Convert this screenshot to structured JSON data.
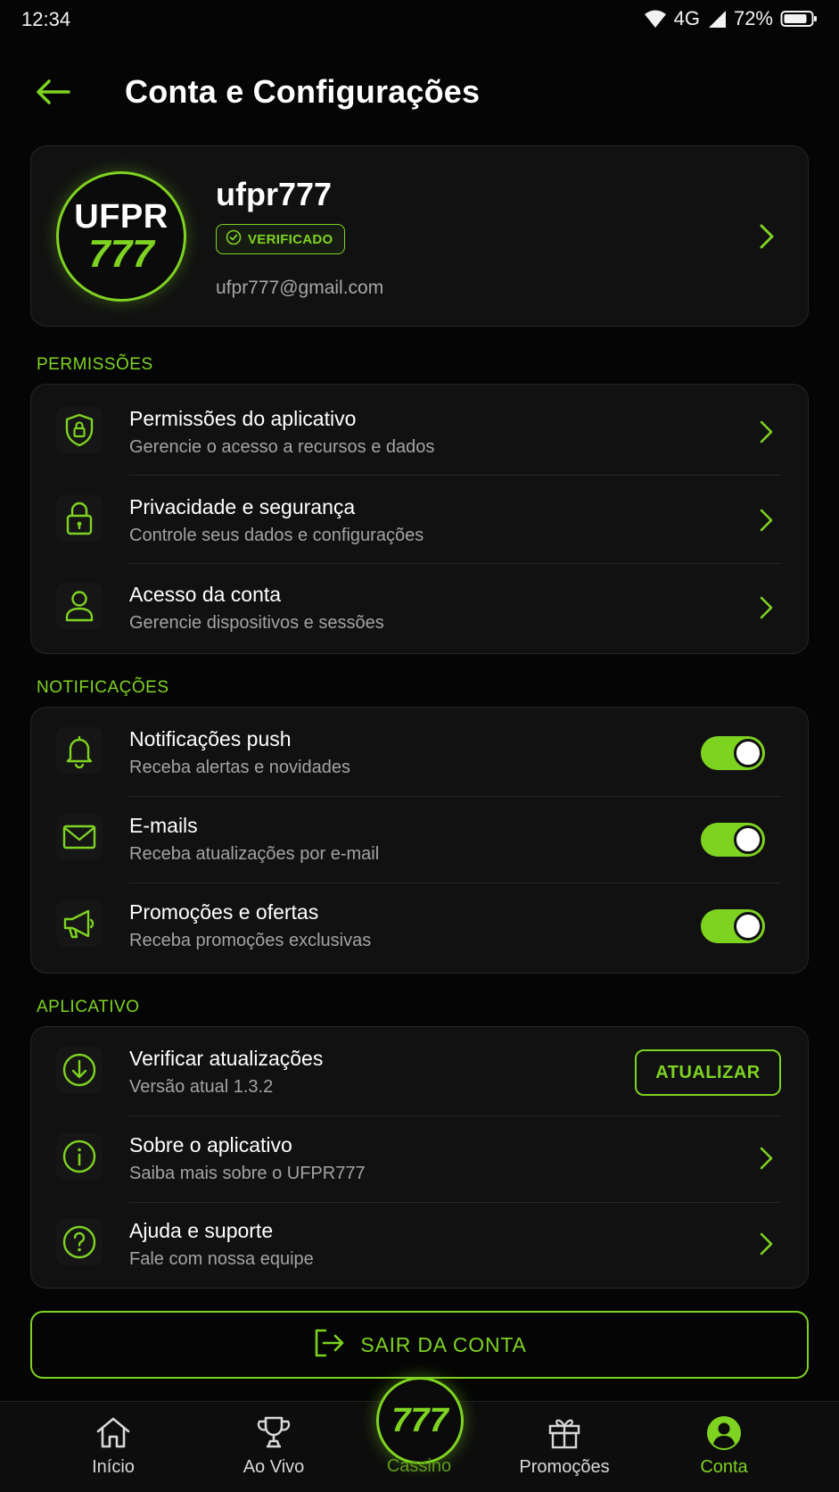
{
  "status_bar": {
    "time": "12:34",
    "network": "4G",
    "battery": "72%"
  },
  "header": {
    "title": "Conta e Configurações"
  },
  "profile": {
    "avatar_top": "UFPR",
    "avatar_bottom": "777",
    "username": "ufpr777",
    "badge": "VERIFICADO",
    "email": "ufpr777@gmail.com"
  },
  "sections": {
    "permissions": {
      "label": "PERMISSÕES",
      "items": [
        {
          "title": "Permissões do aplicativo",
          "subtitle": "Gerencie o acesso a recursos e dados",
          "icon": "shield-lock-icon"
        },
        {
          "title": "Privacidade e segurança",
          "subtitle": "Controle seus dados e configurações",
          "icon": "lock-icon"
        },
        {
          "title": "Acesso da conta",
          "subtitle": "Gerencie dispositivos e sessões",
          "icon": "user-icon"
        }
      ]
    },
    "notifications": {
      "label": "NOTIFICAÇÕES",
      "items": [
        {
          "title": "Notificações push",
          "subtitle": "Receba alertas e novidades",
          "icon": "bell-icon",
          "enabled": true
        },
        {
          "title": "E-mails",
          "subtitle": "Receba atualizações por e-mail",
          "icon": "mail-icon",
          "enabled": true
        },
        {
          "title": "Promoções e ofertas",
          "subtitle": "Receba promoções exclusivas",
          "icon": "megaphone-icon",
          "enabled": true
        }
      ]
    },
    "app": {
      "label": "APLICATIVO",
      "items": [
        {
          "title": "Verificar atualizações",
          "subtitle": "Versão atual 1.3.2",
          "icon": "download-icon",
          "button": "ATUALIZAR"
        },
        {
          "title": "Sobre o aplicativo",
          "subtitle": "Saiba mais sobre o UFPR777",
          "icon": "info-icon"
        },
        {
          "title": "Ajuda e suporte",
          "subtitle": "Fale com nossa equipe",
          "icon": "help-icon"
        }
      ]
    }
  },
  "logout": {
    "label": "SAIR DA CONTA"
  },
  "bottom_nav": {
    "items": [
      {
        "label": "Início",
        "icon": "home-icon"
      },
      {
        "label": "Ao Vivo",
        "icon": "trophy-icon"
      },
      {
        "label": "Cassino",
        "icon": "777-logo",
        "badge": "777"
      },
      {
        "label": "Promoções",
        "icon": "gift-icon"
      },
      {
        "label": "Conta",
        "icon": "account-icon",
        "active": true
      }
    ]
  },
  "colors": {
    "accent": "#7ed321",
    "background": "#050505",
    "card": "#111111",
    "muted_text": "#a3a3a3"
  }
}
